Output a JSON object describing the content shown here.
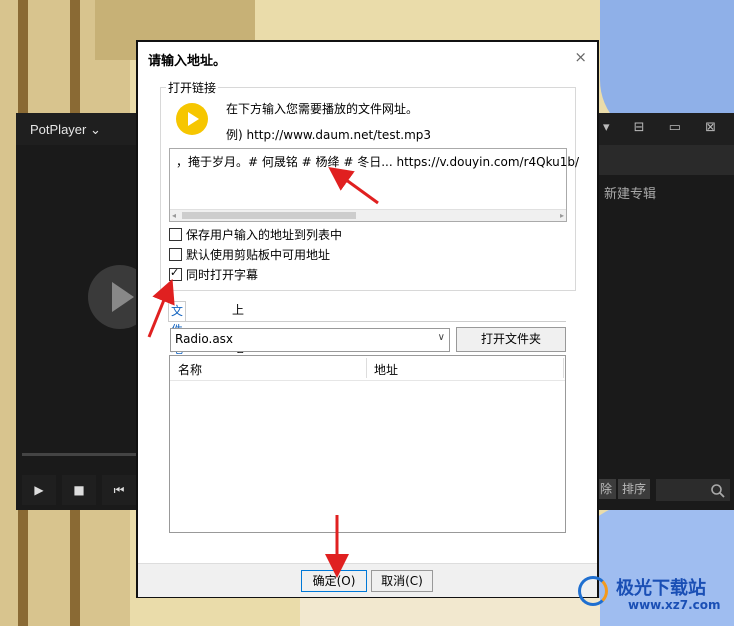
{
  "potplayer": {
    "title": "PotPlayer ⌄",
    "window_controls": "▾ ⊟ ▭ ⊠",
    "side_item": "新建专辑",
    "side_btn_delete": "除",
    "side_btn_sort": "排序",
    "search_icon": "search-icon",
    "controls": [
      "▶",
      "■",
      "⏮"
    ]
  },
  "dialog": {
    "title": "请输入地址。",
    "close_icon": "×",
    "group_label": "打开链接",
    "hint_line1": "在下方输入您需要播放的文件网址。",
    "hint_line2": "例) http://www.daum.net/test.mp3",
    "url_value": "，掩于岁月。# 何晟铭 # 杨绛 # 冬日... https://v.douyin.com/r4Qku1b/",
    "checkboxes": [
      {
        "label": "保存用户输入的地址到列表中",
        "checked": false
      },
      {
        "label": "默认使用剪贴板中可用地址",
        "checked": false
      },
      {
        "label": "同时打开字幕",
        "checked": true
      }
    ],
    "tabs": [
      {
        "label": "文件地址",
        "active": true
      },
      {
        "label": "上一地址",
        "active": false
      }
    ],
    "playlist_select": "Radio.asx",
    "open_folder_button": "打开文件夹",
    "list_columns": {
      "name": "名称",
      "address": "地址"
    },
    "ok_button": "确定(O)",
    "cancel_button": "取消(C)"
  },
  "watermark": {
    "name": "极光下载站",
    "url": "www.xz7.com"
  },
  "colors": {
    "accent_play": "#f6c600",
    "annotation_arrow": "#e02020",
    "link_blue": "#1565c0"
  }
}
